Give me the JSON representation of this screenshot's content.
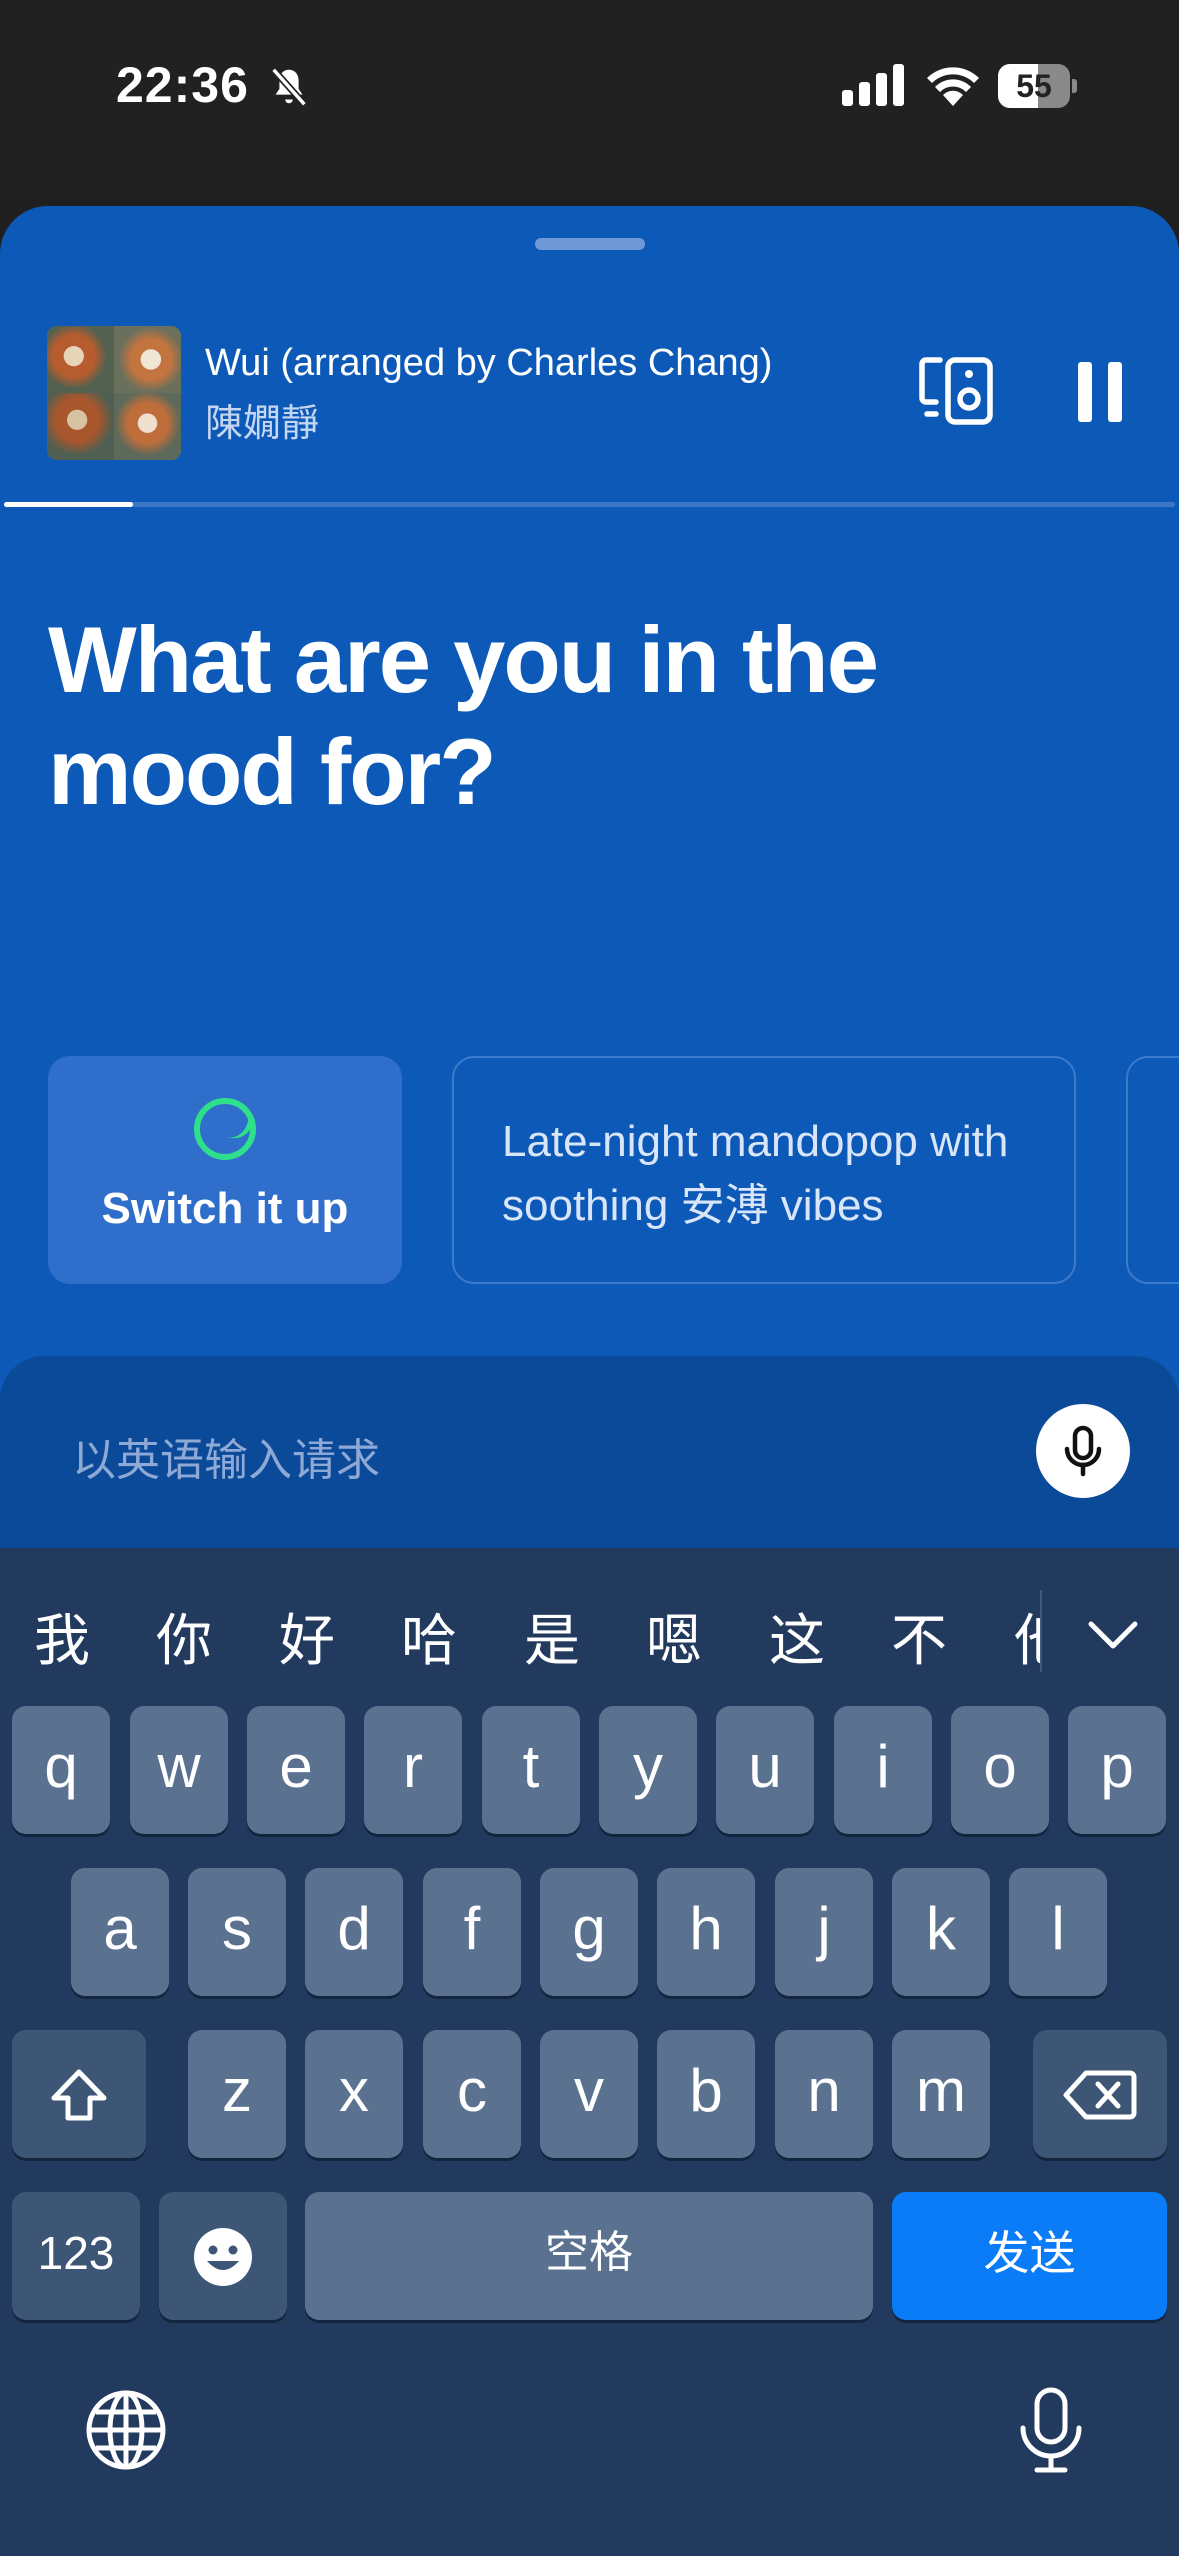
{
  "status_bar": {
    "time": "22:36",
    "battery": "55",
    "battery_level": 0.55,
    "icons": [
      "bell-off-icon",
      "cellular-signal-icon",
      "wifi-icon",
      "battery-icon"
    ]
  },
  "now_playing": {
    "title": "Wui (arranged by Charles Chang)",
    "artist": "陳嫺靜",
    "progress": 0.11,
    "icons": [
      "connect-device-icon",
      "pause-icon"
    ]
  },
  "headline": "What are you in the mood for?",
  "suggestions": {
    "switch_label": "Switch it up",
    "prompt": "Late-night mandopop with soothing 安溥 vibes"
  },
  "input": {
    "placeholder": "以英语输入请求",
    "mic_icon": "microphone-icon"
  },
  "keyboard": {
    "candidates": [
      "我",
      "你",
      "好",
      "哈",
      "是",
      "嗯",
      "这",
      "不",
      "他"
    ],
    "row1": [
      "q",
      "w",
      "e",
      "r",
      "t",
      "y",
      "u",
      "i",
      "o",
      "p"
    ],
    "row2": [
      "a",
      "s",
      "d",
      "f",
      "g",
      "h",
      "j",
      "k",
      "l"
    ],
    "row3": [
      "z",
      "x",
      "c",
      "v",
      "b",
      "n",
      "m"
    ],
    "num_label": "123",
    "space_label": "空格",
    "send_label": "发送",
    "icons": [
      "shift-icon",
      "backspace-icon",
      "emoji-icon",
      "globe-icon",
      "dictation-mic-icon",
      "chevron-down-icon"
    ]
  },
  "colors": {
    "sheet": "#0c59b8",
    "accent_green": "#2fe08a",
    "send_blue": "#0a7cf7",
    "keyboard_bg": "#213a5e"
  }
}
